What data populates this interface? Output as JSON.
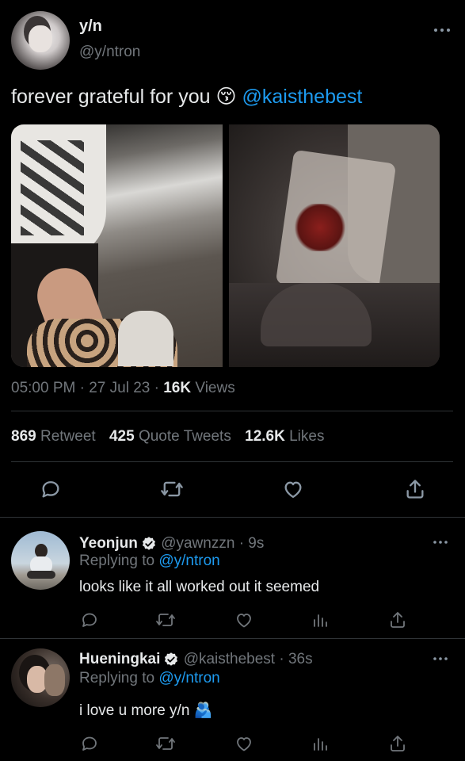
{
  "tweet": {
    "author_name": "y/n",
    "author_handle": "@y/ntron",
    "text": "forever grateful for you 😚",
    "mention": "@kaisthebest",
    "time": "05:00 PM",
    "date": "27 Jul 23",
    "views_count": "16K",
    "views_label": "Views",
    "retweets_count": "869",
    "retweets_label": "Retweet",
    "quotes_count": "425",
    "quotes_label": "Quote Tweets",
    "likes_count": "12.6K",
    "likes_label": "Likes",
    "more_icon": "more-horizontal-icon"
  },
  "replies": [
    {
      "name": "Yeonjun",
      "handle": "@yawnzzn",
      "time": "9s",
      "replying_prefix": "Replying to",
      "replying_to": "@y/ntron",
      "text": "looks like it all worked out it seemed"
    },
    {
      "name": "Hueningkai",
      "handle": "@kaisthebest",
      "time": "36s",
      "replying_prefix": "Replying to",
      "replying_to": "@y/ntron",
      "text": "i love u more y/n 🫂"
    }
  ],
  "separator": "·",
  "colors": {
    "background": "#000000",
    "text": "#e7e9ea",
    "muted": "#71767b",
    "link": "#1d9bf0",
    "divider": "#2f3336"
  }
}
